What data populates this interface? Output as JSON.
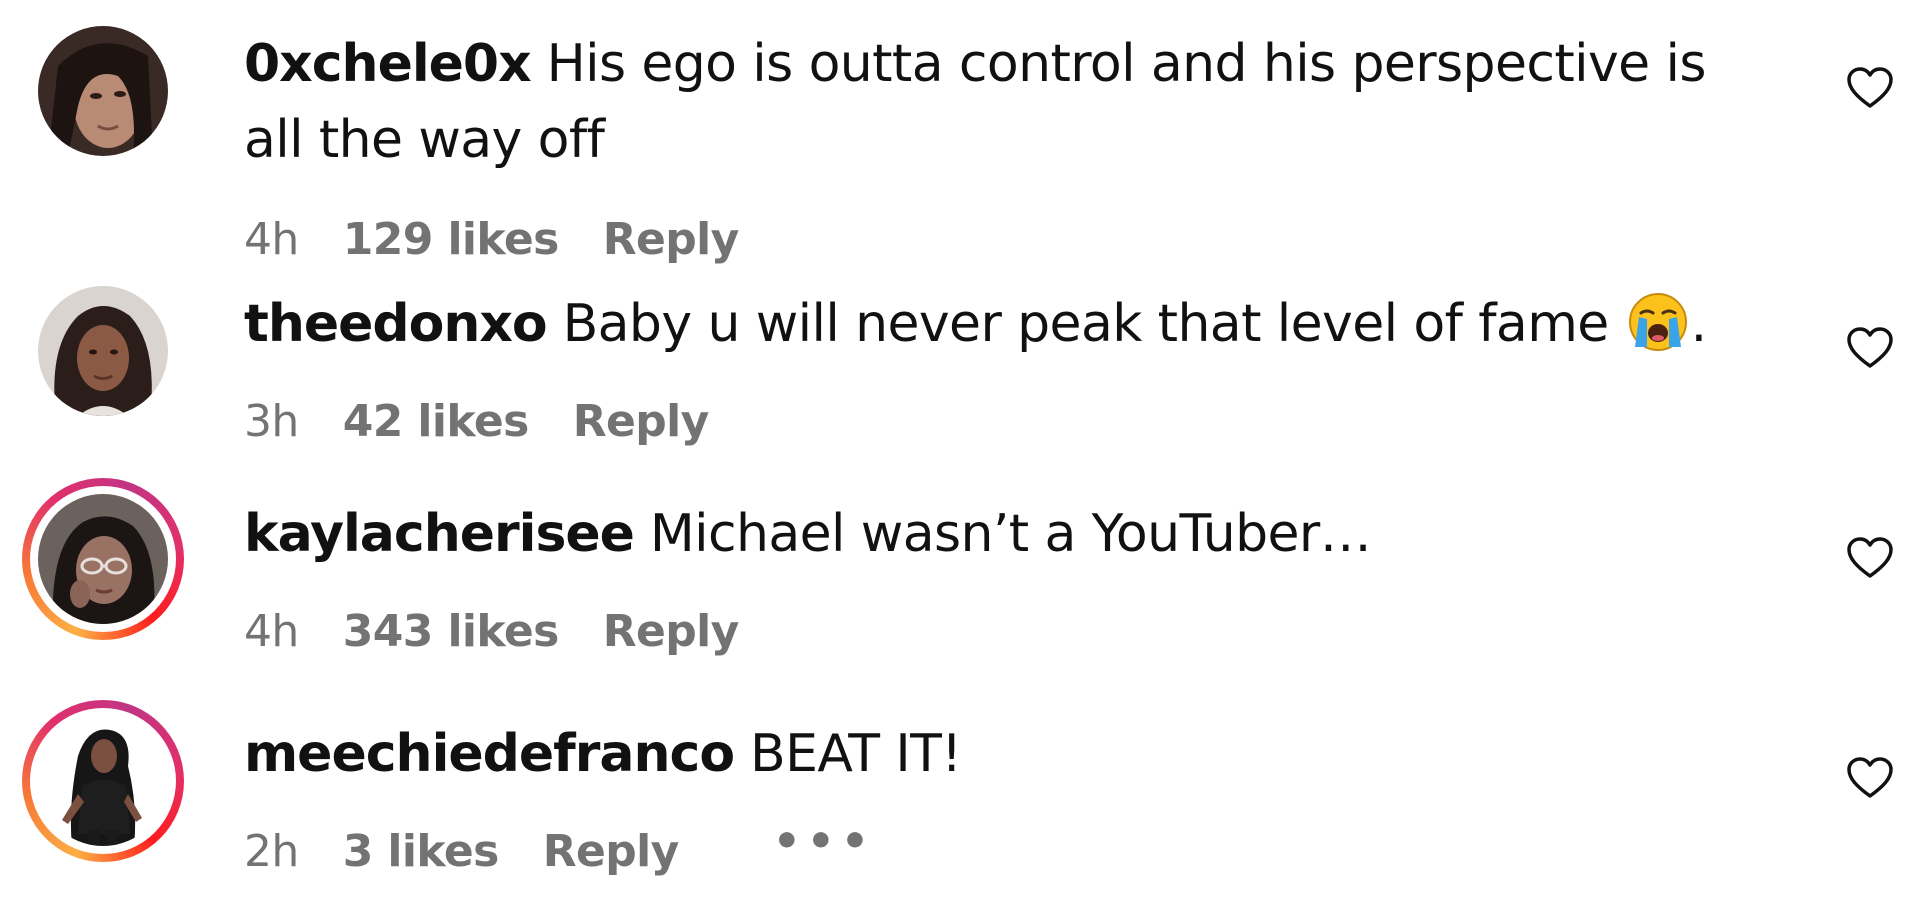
{
  "comments": [
    {
      "username": "0xchele0x",
      "text": "His ego is outta control and his perspective is all the way off",
      "time": "4h",
      "likes": "129 likes",
      "reply": "Reply",
      "avatar_story_ring": false
    },
    {
      "username": "theedonxo",
      "text": "Baby u will never peak that level of fame",
      "text_suffix": ".",
      "emoji": "loudly-crying-face",
      "time": "3h",
      "likes": "42 likes",
      "reply": "Reply",
      "avatar_story_ring": false
    },
    {
      "username": "kaylacherisee",
      "text": "Michael wasn’t a YouTuber…",
      "time": "4h",
      "likes": "343 likes",
      "reply": "Reply",
      "avatar_story_ring": true
    },
    {
      "username": "meechiedefranco",
      "text": "BEAT IT!",
      "time": "2h",
      "likes": "3 likes",
      "reply": "Reply",
      "more": "•••",
      "avatar_story_ring": true
    }
  ],
  "icons": {
    "like": "heart-outline-icon",
    "more": "more-options-icon"
  },
  "colors": {
    "text": "#111111",
    "meta": "#737373",
    "story_ring_start": "#fcaf45",
    "story_ring_end": "#e1306c"
  }
}
